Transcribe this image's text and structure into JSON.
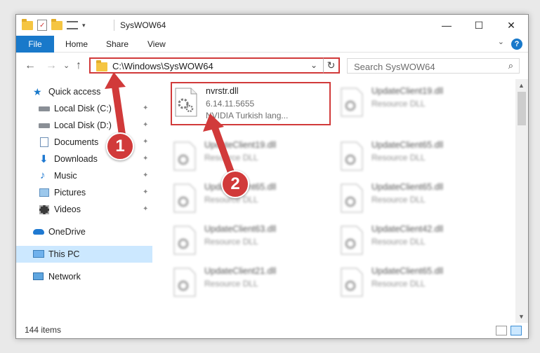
{
  "window": {
    "title": "SysWOW64",
    "minimize": "—",
    "maximize": "☐",
    "close": "✕"
  },
  "ribbon": {
    "tabs": [
      "File",
      "Home",
      "Share",
      "View"
    ],
    "help": "?",
    "collapse": "⌄"
  },
  "nav": {
    "back": "←",
    "forward": "→",
    "recent": "⌄",
    "up": "↑",
    "address": "C:\\Windows\\SysWOW64",
    "address_caret": "⌄",
    "refresh": "↻",
    "search_placeholder": "Search SysWOW64",
    "search_icon": "⌕"
  },
  "sidebar": {
    "items": [
      {
        "label": "Quick access",
        "icon": "star-icon",
        "pinned": false
      },
      {
        "label": "Local Disk (C:)",
        "icon": "drive-icon",
        "pinned": true
      },
      {
        "label": "Local Disk (D:)",
        "icon": "drive-icon",
        "pinned": true
      },
      {
        "label": "Documents",
        "icon": "documents-icon",
        "pinned": true
      },
      {
        "label": "Downloads",
        "icon": "downloads-icon",
        "pinned": true
      },
      {
        "label": "Music",
        "icon": "music-icon",
        "pinned": true
      },
      {
        "label": "Pictures",
        "icon": "pictures-icon",
        "pinned": true
      },
      {
        "label": "Videos",
        "icon": "videos-icon",
        "pinned": true
      },
      {
        "label": "OneDrive",
        "icon": "cloud-icon",
        "pinned": false
      },
      {
        "label": "This PC",
        "icon": "pc-icon",
        "pinned": false,
        "selected": true
      },
      {
        "label": "Network",
        "icon": "network-icon",
        "pinned": false
      }
    ],
    "pin_glyph": "📌"
  },
  "files": [
    {
      "name": "nvrstr.dll",
      "line2": "6.14.11.5655",
      "line3": "NVIDIA Turkish lang...",
      "highlighted": true
    },
    {
      "name": "UpdateClient19.dll",
      "line2": "Resource DLL"
    },
    {
      "name": "UpdateClient19.dll",
      "line2": "Resource DLL"
    },
    {
      "name": "UpdateClient65.dll",
      "line2": "Resource DLL"
    },
    {
      "name": "UpdateClient65.dll",
      "line2": "Resource DLL"
    },
    {
      "name": "UpdateClient65.dll",
      "line2": "Resource DLL"
    },
    {
      "name": "UpdateClient63.dll",
      "line2": "Resource DLL"
    },
    {
      "name": "UpdateClient42.dll",
      "line2": "Resource DLL"
    },
    {
      "name": "UpdateClient21.dll",
      "line2": "Resource DLL"
    },
    {
      "name": "UpdateClient65.dll",
      "line2": "Resource DLL"
    }
  ],
  "status": {
    "count": "144 items"
  },
  "markers": [
    "1",
    "2"
  ],
  "colors": {
    "accent": "#1979ca",
    "highlight": "#d13a3a",
    "selected": "#cce8ff"
  }
}
